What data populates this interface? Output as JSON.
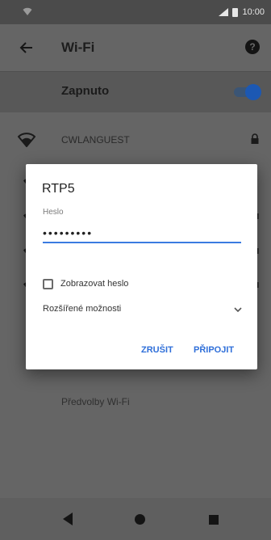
{
  "status_bar": {
    "time": "10:00"
  },
  "app_bar": {
    "title": "Wi-Fi"
  },
  "wifi_switch": {
    "label": "Zapnuto",
    "on": true
  },
  "networks": [
    {
      "name": "CWLANGUEST",
      "locked": true
    }
  ],
  "preferences_label": "Předvolby Wi-Fi",
  "dialog": {
    "title": "RTP5",
    "password_label": "Heslo",
    "password_value": "•••••••••",
    "show_password_label": "Zobrazovat heslo",
    "advanced_options_label": "Rozšířené možnosti",
    "cancel_label": "ZRUŠIT",
    "connect_label": "PŘIPOJIT"
  },
  "colors": {
    "accent": "#2f6fd9",
    "scrim": "#656565"
  }
}
